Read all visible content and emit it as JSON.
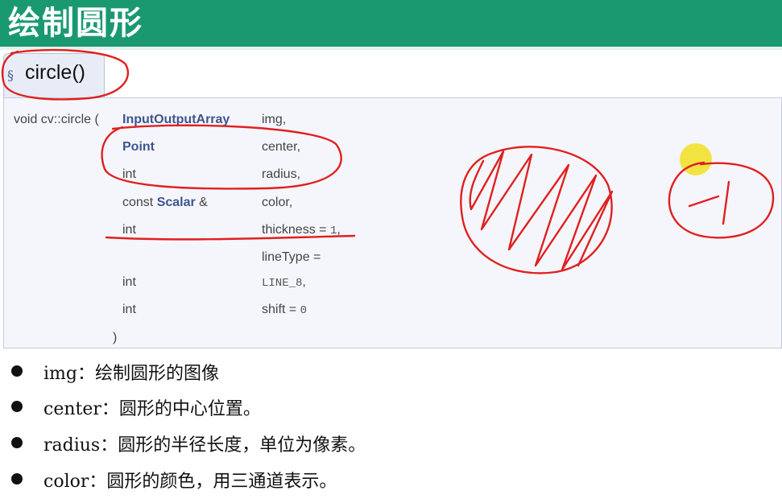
{
  "header": {
    "title": "绘制圆形"
  },
  "tab": {
    "section_mark": "§",
    "function_name": "circle()"
  },
  "signature": {
    "prefix": "void cv::circle (",
    "params": [
      {
        "type": "InputOutputArray",
        "type_is_link": true,
        "name": "img,"
      },
      {
        "type": "Point",
        "type_is_link": true,
        "name": "center,"
      },
      {
        "type": "int",
        "type_is_link": false,
        "name": "radius,"
      },
      {
        "type_prefix": "const ",
        "type": "Scalar",
        "type_suffix": " &",
        "type_is_link": true,
        "name": "color,"
      },
      {
        "type": "int",
        "type_is_link": false,
        "name": "thickness = ",
        "default": "1",
        "tail": ","
      },
      {
        "type": "",
        "type_is_link": false,
        "name": "lineType ="
      },
      {
        "type": "int",
        "type_is_link": false,
        "name_mono": "LINE_8",
        "tail": ","
      },
      {
        "type": "int",
        "type_is_link": false,
        "name": "shift = ",
        "default": "0"
      }
    ],
    "close_paren": ")"
  },
  "bullets": [
    "img：绘制圆形的图像",
    "center：圆形的中心位置。",
    "radius：圆形的半径长度，单位为像素。",
    "color：圆形的颜色，用三通道表示。"
  ],
  "colors": {
    "header_bg": "#1a9970",
    "header_text": "#ffffff",
    "type_link": "#3d558f",
    "annotation": "#e02020",
    "cursor": "#f0e020"
  }
}
